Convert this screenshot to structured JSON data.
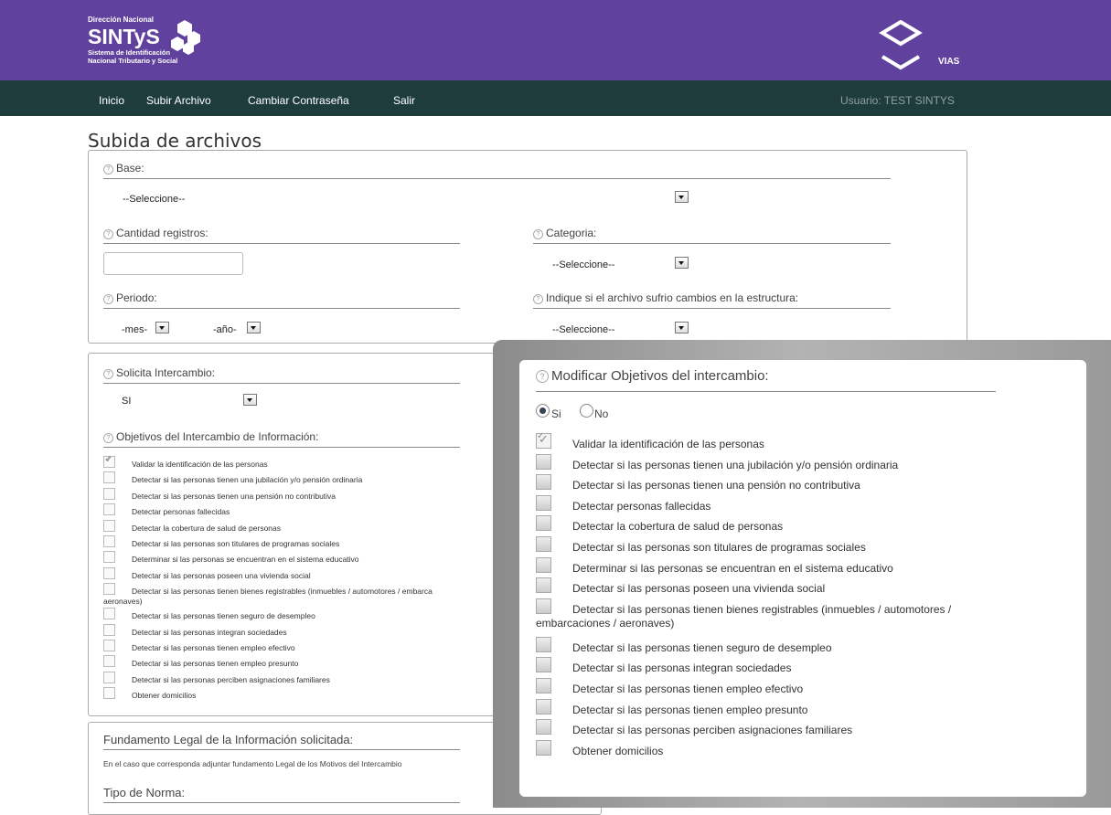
{
  "header": {
    "org_line": "Dirección Nacional",
    "brand": "SINTyS",
    "subtitle_1": "Sistema de Identificación",
    "subtitle_2": "Nacional Tributario y Social",
    "partner": "VIAS",
    "bg_color": "#60429e"
  },
  "nav": {
    "items": [
      "Inicio",
      "Subir Archivo",
      "Cambiar Contraseña",
      "Salir"
    ],
    "user": "Usuario: TEST SINTYS",
    "bg_color": "#1f3c3d"
  },
  "page_title": "Subida de archivos",
  "form1": {
    "base_label": "Base:",
    "base_value": "--Seleccione--",
    "cantidad_label": "Cantidad registros:",
    "cantidad_value": "",
    "categoria_label": "Categoria:",
    "categoria_value": "--Seleccione--",
    "periodo_label": "Periodo:",
    "mes_value": "-mes-",
    "anio_value": "-año-",
    "cambios_label": "Indique si el archivo sufrio cambios en la estructura:",
    "cambios_value": "--Seleccione--"
  },
  "form2": {
    "solicita_label": "Solicita Intercambio:",
    "solicita_value": "SI",
    "objetivos_label": "Objetivos del Intercambio de Información:",
    "objetivos": [
      {
        "label": "Validar la identificación de las personas",
        "checked": true
      },
      {
        "label": "Detectar si las personas tienen una jubilación y/o pensión ordinaria",
        "checked": false
      },
      {
        "label": "Detectar si las personas tienen una pensión no contributiva",
        "checked": false
      },
      {
        "label": "Detectar personas fallecidas",
        "checked": false
      },
      {
        "label": "Detectar la cobertura de salud de personas",
        "checked": false
      },
      {
        "label": "Detectar si las personas son titulares de programas sociales",
        "checked": false
      },
      {
        "label": "Determinar si las personas se encuentran en el sistema educativo",
        "checked": false
      },
      {
        "label": "Detectar si las personas poseen una vivienda social",
        "checked": false
      },
      {
        "label": "Detectar si las personas tienen bienes registrables (inmuebles / automotores / embarca",
        "label_cont": "aeronaves)",
        "checked": false
      },
      {
        "label": "Detectar si las personas tienen seguro de desempleo",
        "checked": false
      },
      {
        "label": "Detectar si las personas integran sociedades",
        "checked": false
      },
      {
        "label": "Detectar si las personas tienen empleo efectivo",
        "checked": false
      },
      {
        "label": "Detectar si las personas tienen empleo presunto",
        "checked": false
      },
      {
        "label": "Detectar si las personas perciben asignaciones familiares",
        "checked": false
      },
      {
        "label": "Obtener domicilios",
        "checked": false
      }
    ]
  },
  "form3": {
    "fundamento_label": "Fundamento Legal de la Información solicitada:",
    "fundamento_note": "En el caso que corresponda adjuntar fundamento Legal de los Motivos del Intercambio",
    "tipo_norma_label": "Tipo de Norma:"
  },
  "overlay": {
    "title": "Modificar Objetivos del intercambio:",
    "radio_si": "Si",
    "radio_no": "No",
    "selected": "Si",
    "objetivos": [
      {
        "label": "Validar la identificación de las personas",
        "checked": true
      },
      {
        "label": "Detectar si las personas tienen una jubilación y/o pensión ordinaria",
        "checked": false
      },
      {
        "label": "Detectar si las personas tienen una pensión no contributiva",
        "checked": false
      },
      {
        "label": "Detectar personas fallecidas",
        "checked": false
      },
      {
        "label": "Detectar la cobertura de salud de personas",
        "checked": false
      },
      {
        "label": "Detectar si las personas son titulares de programas sociales",
        "checked": false
      },
      {
        "label": "Determinar si las personas se encuentran en el sistema educativo",
        "checked": false
      },
      {
        "label": "Detectar si las personas poseen una vivienda social",
        "checked": false
      },
      {
        "label": "Detectar si las personas tienen bienes registrables (inmuebles / automotores /",
        "label_cont": "embarcaciones / aeronaves)",
        "checked": false
      },
      {
        "label": "Detectar si las personas tienen seguro de desempleo",
        "checked": false
      },
      {
        "label": "Detectar si las personas integran sociedades",
        "checked": false
      },
      {
        "label": "Detectar si las personas tienen empleo efectivo",
        "checked": false
      },
      {
        "label": "Detectar si las personas tienen empleo presunto",
        "checked": false
      },
      {
        "label": "Detectar si las personas perciben asignaciones familiares",
        "checked": false
      },
      {
        "label": "Obtener domicilios",
        "checked": false
      }
    ]
  }
}
